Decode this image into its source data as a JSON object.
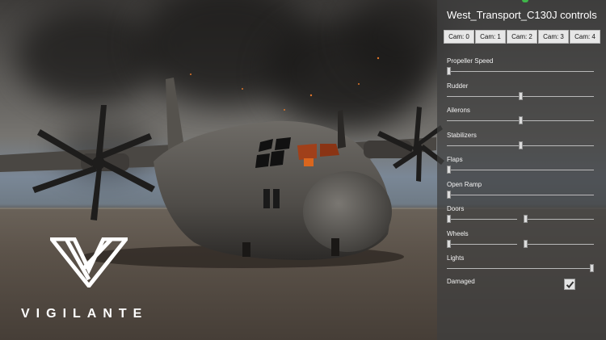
{
  "panel": {
    "title": "West_Transport_C130J controls",
    "cameras": [
      "Cam: 0",
      "Cam: 1",
      "Cam: 2",
      "Cam: 3",
      "Cam: 4"
    ],
    "controls": [
      {
        "label": "Propeller Speed",
        "values": [
          0
        ]
      },
      {
        "label": "Rudder",
        "values": [
          0.5
        ]
      },
      {
        "label": "Ailerons",
        "values": [
          0.5
        ]
      },
      {
        "label": "Stabilizers",
        "values": [
          0.5
        ]
      },
      {
        "label": "Flaps",
        "values": [
          0
        ]
      },
      {
        "label": "Open Ramp",
        "values": [
          0
        ]
      },
      {
        "label": "Doors",
        "values": [
          0,
          0
        ]
      },
      {
        "label": "Wheels",
        "values": [
          0,
          0
        ]
      },
      {
        "label": "Lights",
        "values": [
          1
        ]
      }
    ],
    "damaged_label": "Damaged",
    "damaged_checked": true
  },
  "brand": {
    "wordmark": "VIGILANTE",
    "logo_icon": "vigilante-v-logo"
  },
  "scene": {
    "subject": "c130j-aircraft-render"
  },
  "colors": {
    "panel_bg": "#3e3e3e",
    "indicator": "#3fb64a"
  }
}
